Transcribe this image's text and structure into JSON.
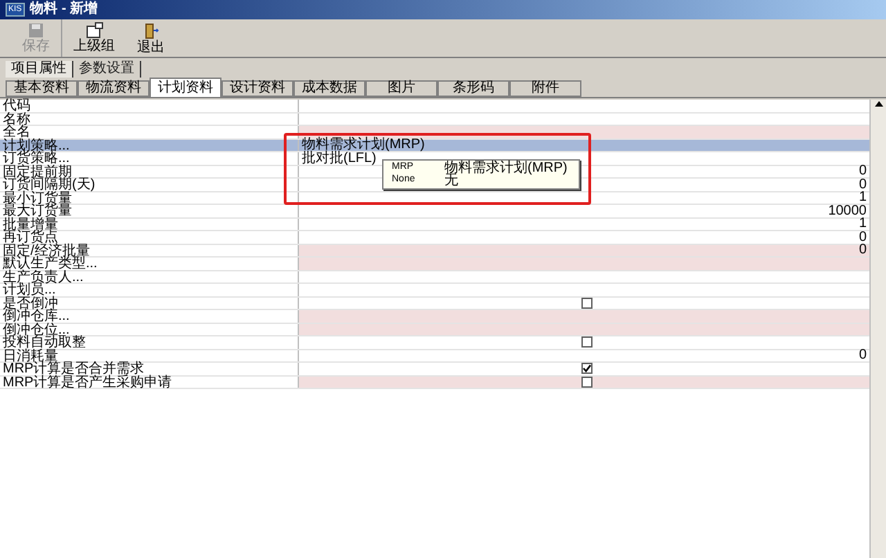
{
  "window": {
    "logo": "KIS",
    "title": "物料 - 新增"
  },
  "toolbar": [
    {
      "label": "保存",
      "disabled": true,
      "kind": "save"
    },
    {
      "label": "上级组",
      "disabled": false,
      "kind": "group"
    },
    {
      "label": "退出",
      "disabled": false,
      "kind": "exit"
    }
  ],
  "section_tabs": [
    {
      "label": "项目属性",
      "selected": true
    },
    {
      "label": "参数设置",
      "selected": false
    }
  ],
  "tabs": [
    {
      "label": "基本资料",
      "selected": false
    },
    {
      "label": "物流资料",
      "selected": false
    },
    {
      "label": "计划资料",
      "selected": true
    },
    {
      "label": "设计资料",
      "selected": false
    },
    {
      "label": "成本数据",
      "selected": false
    },
    {
      "label": "图片",
      "selected": false
    },
    {
      "label": "条形码",
      "selected": false
    },
    {
      "label": "附件",
      "selected": false
    }
  ],
  "rows": [
    {
      "label": "代码",
      "kind": "text",
      "required": false,
      "selected": false
    },
    {
      "label": "名称",
      "kind": "text",
      "required": false,
      "selected": false
    },
    {
      "label": "全名",
      "kind": "text",
      "required": true,
      "selected": false
    },
    {
      "label": "计划策略...",
      "kind": "text",
      "value": "物料需求计划(MRP)",
      "required": false,
      "selected": true
    },
    {
      "label": "订货策略...",
      "kind": "text",
      "value": "批对批(LFL)",
      "required": false,
      "selected": false
    },
    {
      "label": "固定提前期",
      "kind": "number",
      "value": "0",
      "required": false,
      "selected": false
    },
    {
      "label": "订货间隔期(天)",
      "kind": "number",
      "value": "0",
      "required": false,
      "selected": false
    },
    {
      "label": "最小订货量",
      "kind": "number",
      "value": "1",
      "required": false,
      "selected": false
    },
    {
      "label": "最大订货量",
      "kind": "number",
      "value": "10000",
      "required": false,
      "selected": false
    },
    {
      "label": "批量增量",
      "kind": "number",
      "value": "1",
      "required": false,
      "selected": false
    },
    {
      "label": "再订货点",
      "kind": "number",
      "value": "0",
      "required": false,
      "selected": false
    },
    {
      "label": "固定/经济批量",
      "kind": "number",
      "value": "0",
      "required": true,
      "selected": false
    },
    {
      "label": "默认生产类型...",
      "kind": "text",
      "required": true,
      "selected": false
    },
    {
      "label": "生产负责人...",
      "kind": "text",
      "required": false,
      "selected": false
    },
    {
      "label": "计划员...",
      "kind": "text",
      "required": false,
      "selected": false
    },
    {
      "label": "是否倒冲",
      "kind": "checkbox",
      "checked": false,
      "required": false,
      "selected": false
    },
    {
      "label": "倒冲仓库...",
      "kind": "text",
      "required": true,
      "selected": false
    },
    {
      "label": "倒冲仓位...",
      "kind": "text",
      "required": true,
      "selected": false
    },
    {
      "label": "投料自动取整",
      "kind": "checkbox",
      "checked": false,
      "required": false,
      "selected": false
    },
    {
      "label": "日消耗量",
      "kind": "number",
      "value": "0",
      "required": false,
      "selected": false
    },
    {
      "label": "MRP计算是否合并需求",
      "kind": "checkbox",
      "checked": true,
      "required": false,
      "selected": false
    },
    {
      "label": "MRP计算是否产生采购申请",
      "kind": "checkbox",
      "checked": false,
      "required": true,
      "selected": false
    }
  ],
  "dropdown": {
    "options": [
      {
        "code": "MRP",
        "name": "物料需求计划(MRP)"
      },
      {
        "code": "None",
        "name": "无"
      }
    ]
  }
}
